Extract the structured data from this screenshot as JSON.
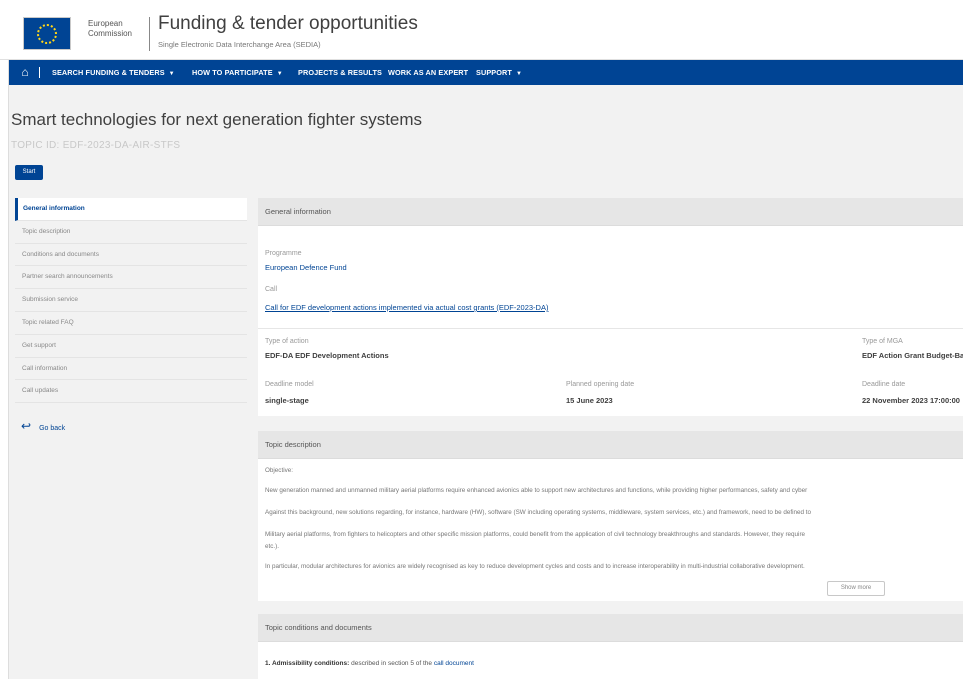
{
  "header": {
    "org_line1": "European",
    "org_line2": "Commission",
    "title": "Funding & tender opportunities",
    "subtitle": "Single Electronic Data Interchange Area (SEDIA)"
  },
  "nav": {
    "home_icon": "home-icon",
    "items": [
      {
        "label": "SEARCH FUNDING & TENDERS",
        "dropdown": true
      },
      {
        "label": "HOW TO PARTICIPATE",
        "dropdown": true
      },
      {
        "label": "PROJECTS & RESULTS",
        "dropdown": false
      },
      {
        "label": "WORK AS AN EXPERT",
        "dropdown": false
      },
      {
        "label": "SUPPORT",
        "dropdown": true
      }
    ]
  },
  "page": {
    "title": "Smart technologies for next generation fighter systems",
    "topic_id": "TOPIC ID: EDF-2023-DA-AIR-STFS",
    "start_button": "Start"
  },
  "sidenav": {
    "items": [
      "General information",
      "Topic description",
      "Conditions and documents",
      "Partner search announcements",
      "Submission service",
      "Topic related FAQ",
      "Get support",
      "Call information",
      "Call updates"
    ],
    "active_index": 0,
    "go_back": "Go back"
  },
  "general_info": {
    "heading": "General information",
    "programme_label": "Programme",
    "programme_value": "European Defence Fund",
    "call_label": "Call",
    "call_value": "Call for EDF development actions implemented via actual cost grants (EDF-2023-DA)",
    "type_action_label": "Type of action",
    "type_action_value": "EDF-DA EDF Development Actions",
    "type_mga_label": "Type of MGA",
    "type_mga_value": "EDF Action Grant Budget-Based",
    "deadline_model_label": "Deadline model",
    "deadline_model_value": "single-stage",
    "opening_label": "Planned opening date",
    "opening_value": "15 June 2023",
    "deadline_label": "Deadline date",
    "deadline_value": "22 November 2023 17:00:00"
  },
  "topic_description": {
    "heading": "Topic description",
    "objective": "Objective:",
    "paragraphs": [
      "New generation manned and unmanned military aerial platforms require enhanced avionics able to support new architectures and functions, while providing higher performances, safety and cyber",
      "Against this background, new solutions regarding, for instance, hardware (HW), software (SW including operating systems, middleware, system services, etc.) and framework, need to be defined to",
      "Military aerial platforms, from fighters to helicopters and other specific mission platforms, could benefit from the application of civil technology breakthroughs and standards. However, they require",
      "etc.).",
      "In particular, modular architectures for avionics are widely recognised as key to reduce development cycles and costs and to increase interoperability in multi-industrial collaborative development."
    ],
    "show_more": "Show more"
  },
  "conditions": {
    "heading": "Topic conditions and documents",
    "line_bold": "1. Admissibility conditions:",
    "line_text": "described in section 5 of the",
    "line_link": "call document"
  }
}
